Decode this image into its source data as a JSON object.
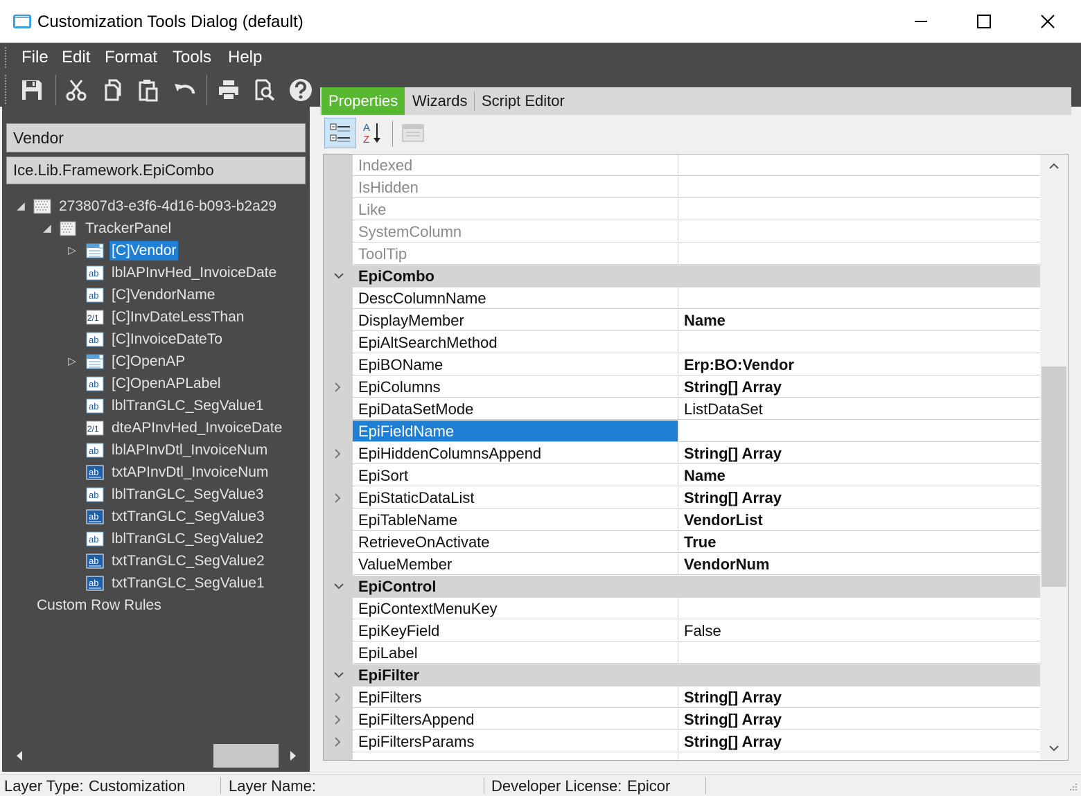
{
  "window": {
    "title": "Customization Tools Dialog (default)",
    "icon": "app-window-icon",
    "controls": [
      "minimize-icon",
      "maximize-icon",
      "close-icon"
    ]
  },
  "menu": [
    "File",
    "Edit",
    "Format",
    "Tools",
    "Help"
  ],
  "toolbar": [
    "save-icon",
    "cut-icon",
    "copy-icon",
    "paste-icon",
    "undo-icon",
    "print-icon",
    "print-preview-icon",
    "help-icon"
  ],
  "left": {
    "control_name": "Vendor",
    "control_type": "Ice.Lib.Framework.EpiCombo",
    "tree": [
      {
        "label": "273807d3-e3f6-4d16-b093-b2a29",
        "icon": "form-icon",
        "expanded": true,
        "selected": false
      },
      {
        "label": "TrackerPanel",
        "icon": "panel-icon",
        "expanded": true,
        "selected": false
      },
      {
        "label": "[C]Vendor",
        "icon": "combo-icon",
        "expandable": true,
        "selected": true
      },
      {
        "label": "lblAPInvHed_InvoiceDate",
        "icon": "label-icon",
        "selected": false
      },
      {
        "label": "[C]VendorName",
        "icon": "label-icon",
        "selected": false
      },
      {
        "label": "[C]InvDateLessThan",
        "icon": "date-icon",
        "selected": false
      },
      {
        "label": "[C]InvoiceDateTo",
        "icon": "label-icon",
        "selected": false
      },
      {
        "label": "[C]OpenAP",
        "icon": "combo-icon",
        "expandable": true,
        "selected": false
      },
      {
        "label": "[C]OpenAPLabel",
        "icon": "label-icon",
        "selected": false
      },
      {
        "label": "lblTranGLC_SegValue1",
        "icon": "label-icon",
        "selected": false
      },
      {
        "label": "dteAPInvHed_InvoiceDate",
        "icon": "date-icon",
        "selected": false
      },
      {
        "label": "lblAPInvDtl_InvoiceNum",
        "icon": "label-icon",
        "selected": false
      },
      {
        "label": "txtAPInvDtl_InvoiceNum",
        "icon": "textbox-icon",
        "selected": false
      },
      {
        "label": "lblTranGLC_SegValue3",
        "icon": "label-icon",
        "selected": false
      },
      {
        "label": "txtTranGLC_SegValue3",
        "icon": "textbox-icon",
        "selected": false
      },
      {
        "label": "lblTranGLC_SegValue2",
        "icon": "label-icon",
        "selected": false
      },
      {
        "label": "txtTranGLC_SegValue2",
        "icon": "textbox-icon",
        "selected": false
      },
      {
        "label": "txtTranGLC_SegValue1",
        "icon": "textbox-icon",
        "selected": false
      },
      {
        "label": "Custom Row Rules",
        "icon": "",
        "selected": false
      }
    ]
  },
  "tabs": [
    {
      "label": "Properties",
      "active": true
    },
    {
      "label": "Wizards",
      "active": false
    },
    {
      "label": "Script Editor",
      "active": false
    }
  ],
  "property_tools": [
    "categorized-icon",
    "alphabetical-sort-icon",
    "property-pages-icon"
  ],
  "properties": [
    {
      "kind": "row",
      "name": "Indexed",
      "value": "",
      "disabled": true
    },
    {
      "kind": "row",
      "name": "IsHidden",
      "value": "",
      "disabled": true
    },
    {
      "kind": "row",
      "name": "Like",
      "value": "",
      "disabled": true
    },
    {
      "kind": "row",
      "name": "SystemColumn",
      "value": "",
      "disabled": true
    },
    {
      "kind": "row",
      "name": "ToolTip",
      "value": "",
      "disabled": true
    },
    {
      "kind": "category",
      "name": "EpiCombo"
    },
    {
      "kind": "row",
      "name": "DescColumnName",
      "value": ""
    },
    {
      "kind": "row",
      "name": "DisplayMember",
      "value": "Name",
      "bold": true
    },
    {
      "kind": "row",
      "name": "EpiAltSearchMethod",
      "value": ""
    },
    {
      "kind": "row",
      "name": "EpiBOName",
      "value": "Erp:BO:Vendor",
      "bold": true
    },
    {
      "kind": "row",
      "name": "EpiColumns",
      "value": "String[] Array",
      "bold": true,
      "expandable": true
    },
    {
      "kind": "row",
      "name": "EpiDataSetMode",
      "value": "ListDataSet"
    },
    {
      "kind": "row",
      "name": "EpiFieldName",
      "value": "",
      "selected": true
    },
    {
      "kind": "row",
      "name": "EpiHiddenColumnsAppend",
      "value": "String[] Array",
      "bold": true,
      "expandable": true
    },
    {
      "kind": "row",
      "name": "EpiSort",
      "value": "Name",
      "bold": true
    },
    {
      "kind": "row",
      "name": "EpiStaticDataList",
      "value": "String[] Array",
      "bold": true,
      "expandable": true
    },
    {
      "kind": "row",
      "name": "EpiTableName",
      "value": "VendorList",
      "bold": true
    },
    {
      "kind": "row",
      "name": "RetrieveOnActivate",
      "value": "True",
      "bold": true
    },
    {
      "kind": "row",
      "name": "ValueMember",
      "value": "VendorNum",
      "bold": true
    },
    {
      "kind": "category",
      "name": "EpiControl"
    },
    {
      "kind": "row",
      "name": "EpiContextMenuKey",
      "value": ""
    },
    {
      "kind": "row",
      "name": "EpiKeyField",
      "value": "False"
    },
    {
      "kind": "row",
      "name": "EpiLabel",
      "value": ""
    },
    {
      "kind": "category",
      "name": "EpiFilter"
    },
    {
      "kind": "row",
      "name": "EpiFilters",
      "value": "String[] Array",
      "bold": true,
      "expandable": true
    },
    {
      "kind": "row",
      "name": "EpiFiltersAppend",
      "value": "String[] Array",
      "bold": true,
      "expandable": true
    },
    {
      "kind": "row",
      "name": "EpiFiltersParams",
      "value": "String[] Array",
      "bold": true,
      "expandable": true
    },
    {
      "kind": "row",
      "name": "",
      "value": ""
    }
  ],
  "status": {
    "layer_type_label": "Layer Type:",
    "layer_type": "Customization",
    "layer_name_label": "Layer Name:",
    "layer_name": "",
    "license_label": "Developer License:",
    "license": "Epicor"
  }
}
